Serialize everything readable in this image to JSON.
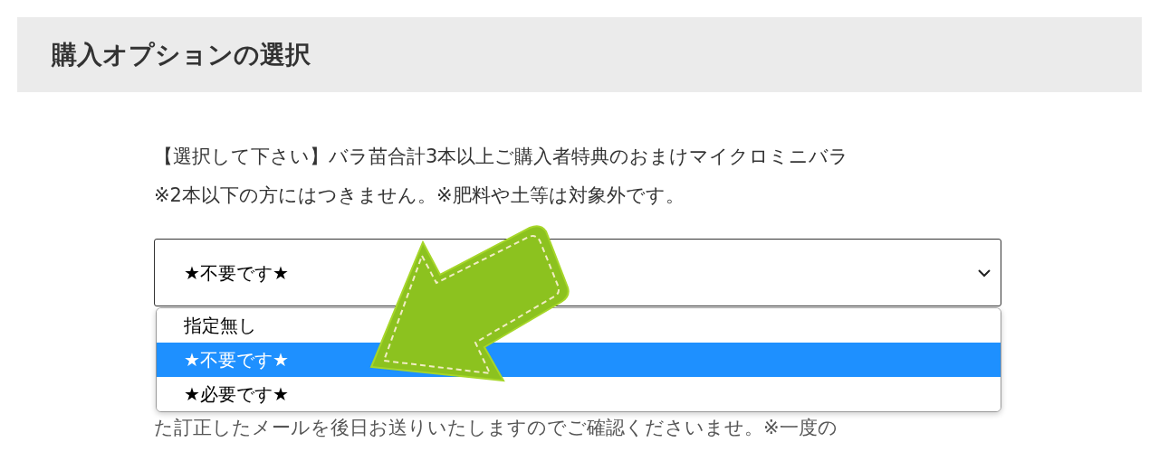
{
  "section_heading": "購入オプションの選択",
  "intro_lines": [
    "【選択して下さい】バラ苗合計3本以上ご購入者特典のおまけマイクロミニバラ",
    "※2本以下の方にはつきません。※肥料や土等は対象外です。"
  ],
  "select": {
    "value": "★不要です★",
    "expanded": true
  },
  "options": [
    {
      "label": "指定無し",
      "selected": false
    },
    {
      "label": "★不要です★",
      "selected": true
    },
    {
      "label": "★必要です★",
      "selected": false
    }
  ],
  "note_lines": [
    "た訂正したメールを後日お送りいたしますのでご確認くださいませ。※一度の"
  ]
}
